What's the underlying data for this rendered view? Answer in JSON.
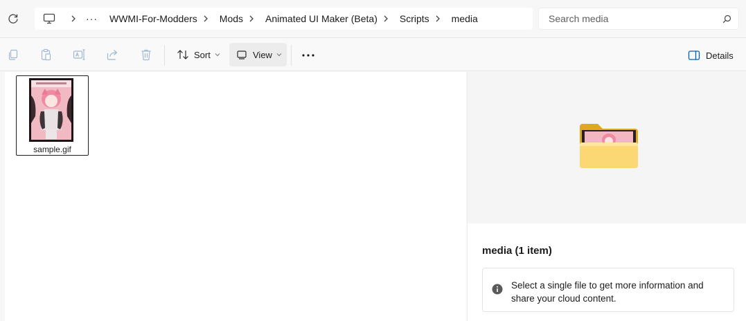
{
  "breadcrumb": {
    "items": [
      {
        "label": "WWMI-For-Modders"
      },
      {
        "label": "Mods"
      },
      {
        "label": "Animated UI Maker (Beta)"
      },
      {
        "label": "Scripts"
      },
      {
        "label": "media"
      }
    ],
    "overflow": "···"
  },
  "search": {
    "placeholder": "Search media"
  },
  "toolbar": {
    "sort_label": "Sort",
    "view_label": "View",
    "details_label": "Details"
  },
  "files": [
    {
      "name": "sample.gif"
    }
  ],
  "details_pane": {
    "title": "media (1 item)",
    "info_text": "Select a single file to get more information and share your cloud content."
  },
  "colors": {
    "accent": "#005fb8",
    "folder": "#f4c44b",
    "disabled_icon": "#a0b8d2"
  }
}
